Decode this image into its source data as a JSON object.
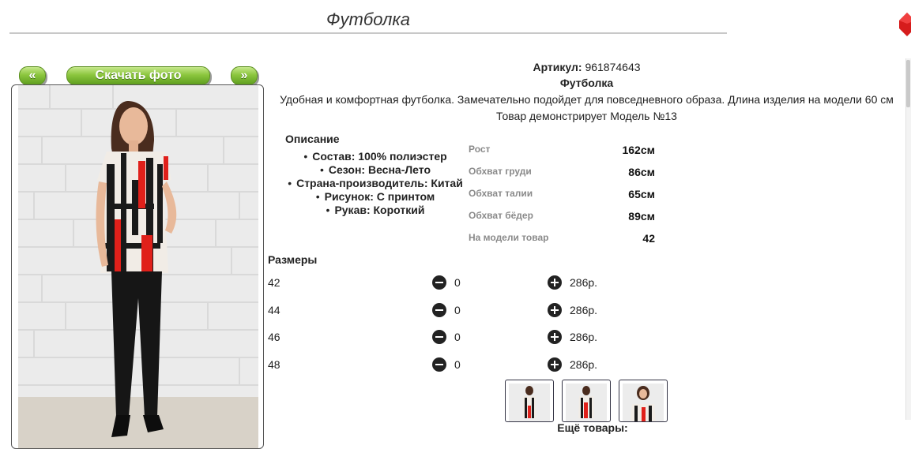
{
  "header": {
    "title": "Футболка"
  },
  "gallery": {
    "prev_label": "«",
    "download_label": "Скачать фото",
    "next_label": "»"
  },
  "product": {
    "article_label": "Артикул:",
    "article_value": "961874643",
    "name": "Футболка",
    "description": "Удобная и комфортная футболка. Замечательно подойдет для повседневного образа. Длина изделия на модели 60 см",
    "model_note": "Товар демонстрирует Модель №13"
  },
  "description": {
    "title": "Описание",
    "items": [
      "Состав: 100% полиэстер",
      "Сезон: Весна-Лето",
      "Страна-производитель: Китай",
      "Рисунок: С принтом",
      "Рукав: Короткий"
    ]
  },
  "model_params": [
    {
      "label": "Рост",
      "value": "162см"
    },
    {
      "label": "Обхват груди",
      "value": "86см"
    },
    {
      "label": "Обхват талии",
      "value": "65см"
    },
    {
      "label": "Обхват бёдер",
      "value": "89см"
    },
    {
      "label": "На модели товар",
      "value": "42"
    }
  ],
  "sizes": {
    "title": "Размеры",
    "rows": [
      {
        "size": "42",
        "qty": "0",
        "price": "286р."
      },
      {
        "size": "44",
        "qty": "0",
        "price": "286р."
      },
      {
        "size": "46",
        "qty": "0",
        "price": "286р."
      },
      {
        "size": "48",
        "qty": "0",
        "price": "286р."
      }
    ]
  },
  "more_label": "Ещё товары:",
  "colors": {
    "button_green": "#8cc63e",
    "close_red": "#e02020",
    "print_red": "#e0201a"
  }
}
